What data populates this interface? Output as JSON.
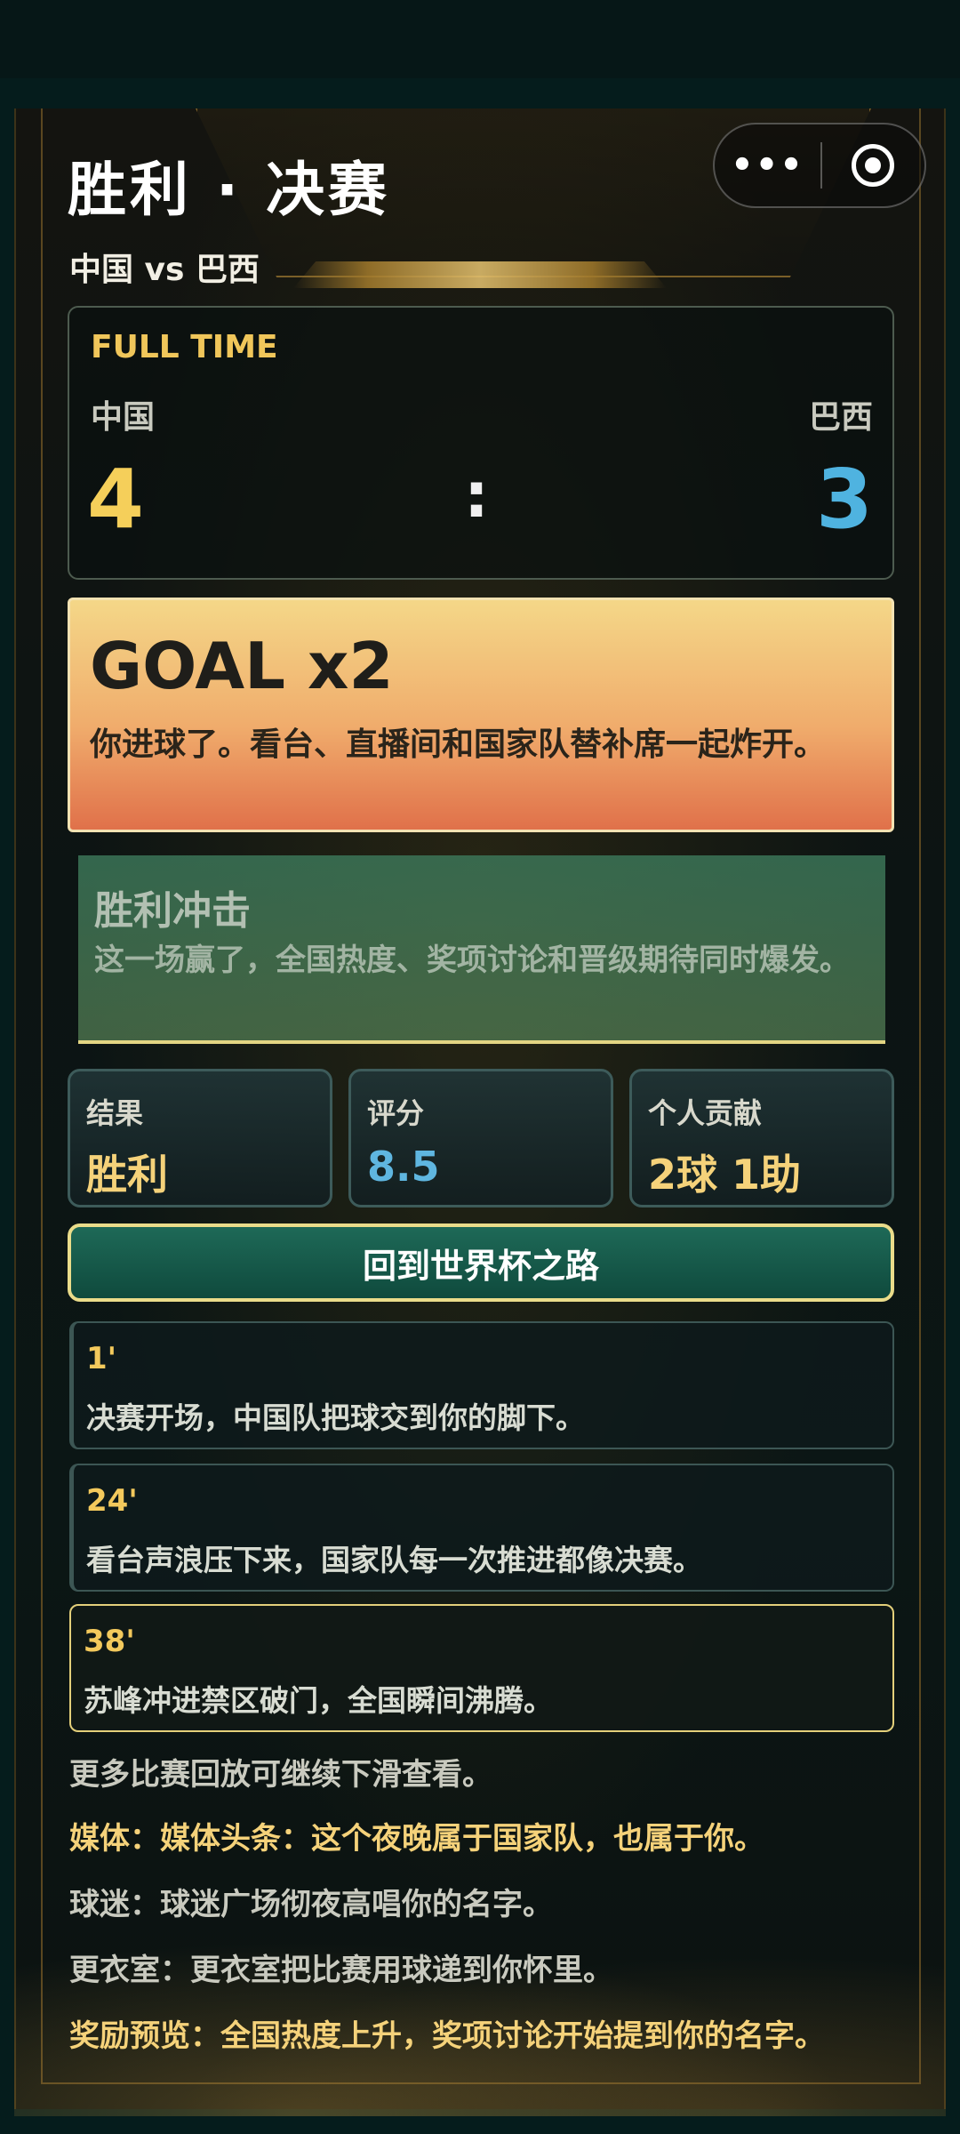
{
  "header": {
    "title": "胜利 · 决赛",
    "subtitle": "中国 vs 巴西",
    "capsule": {
      "more_label": "•••",
      "more_icon": "more-dots-icon",
      "close_icon": "target-icon"
    }
  },
  "score": {
    "status": "FULL TIME",
    "home": {
      "name": "中国",
      "goals": "4",
      "color": "#f5cf5a"
    },
    "away": {
      "name": "巴西",
      "goals": "3",
      "color": "#4fb3e0"
    },
    "separator": ":"
  },
  "goal": {
    "title": "GOAL x2",
    "text": "你进球了。看台、直播间和国家队替补席一起炸开。"
  },
  "impact": {
    "title": "胜利冲击",
    "text": "这一场赢了，全国热度、奖项讨论和晋级期待同时爆发。"
  },
  "stats": [
    {
      "label": "结果",
      "value": "胜利",
      "color": "#f5d27a"
    },
    {
      "label": "评分",
      "value": "8.5",
      "color": "#5fb6e0"
    },
    {
      "label": "个人贡献",
      "value": "2球 1助",
      "color": "#f5d27a"
    }
  ],
  "road_button": "回到世界杯之路",
  "events": [
    {
      "minute": "1'",
      "text": "决赛开场，中国队把球交到你的脚下。",
      "highlight": false
    },
    {
      "minute": "24'",
      "text": "看台声浪压下来，国家队每一次推进都像决赛。",
      "highlight": false
    },
    {
      "minute": "38'",
      "text": "苏峰冲进禁区破门，全国瞬间沸腾。",
      "highlight": true
    }
  ],
  "more_hint": "更多比赛回放可继续下滑查看。",
  "notes": [
    {
      "text": "媒体：媒体头条：这个夜晚属于国家队，也属于你。",
      "color": "#f5d27a"
    },
    {
      "text": "球迷：球迷广场彻夜高唱你的名字。",
      "color": "#c9cabf"
    },
    {
      "text": "更衣室：更衣室把比赛用球递到你怀里。",
      "color": "#c9cabf"
    },
    {
      "text": "奖励预览：全国热度上升，奖项讨论开始提到你的名字。",
      "color": "#f5d27a"
    }
  ]
}
